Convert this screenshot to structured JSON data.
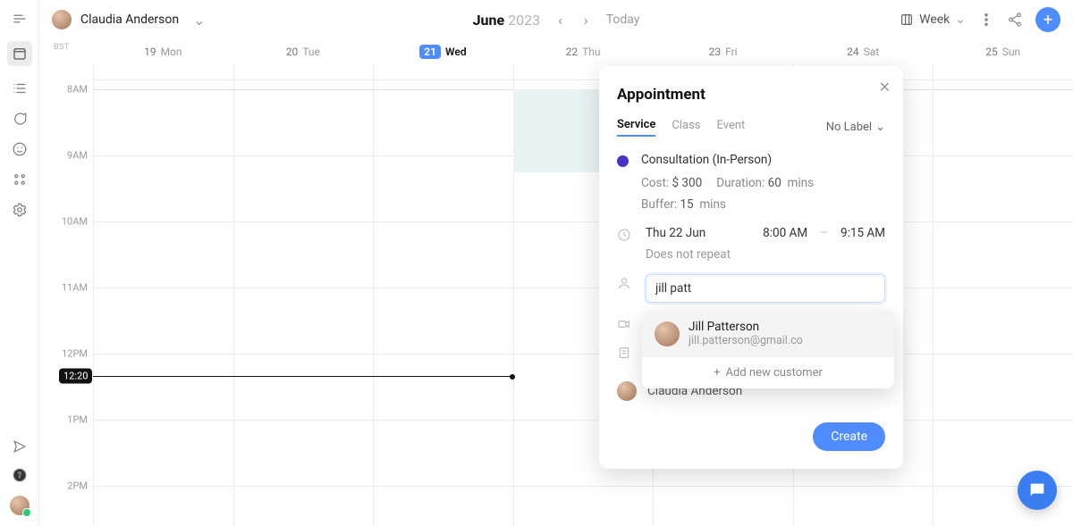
{
  "user": {
    "name": "Claudia Anderson"
  },
  "header": {
    "month": "June",
    "year": "2023",
    "today_label": "Today",
    "view_label": "Week"
  },
  "timezone": "BST",
  "now": "12:20",
  "days": [
    {
      "num": "19",
      "dow": "Mon"
    },
    {
      "num": "20",
      "dow": "Tue"
    },
    {
      "num": "21",
      "dow": "Wed",
      "active": true
    },
    {
      "num": "22",
      "dow": "Thu"
    },
    {
      "num": "23",
      "dow": "Fri"
    },
    {
      "num": "24",
      "dow": "Sat"
    },
    {
      "num": "25",
      "dow": "Sun"
    }
  ],
  "hours": [
    "8AM",
    "9AM",
    "10AM",
    "11AM",
    "12PM",
    "1PM",
    "2PM"
  ],
  "modal": {
    "title": "Appointment",
    "tabs": {
      "service": "Service",
      "class": "Class",
      "event": "Event"
    },
    "label_dropdown": "No Label",
    "service_name": "Consultation (In-Person)",
    "cost_label": "Cost:",
    "cost_value": "$ 300",
    "duration_label": "Duration:",
    "duration_value": "60",
    "duration_unit": "mins",
    "buffer_label": "Buffer:",
    "buffer_value": "15",
    "buffer_unit": "mins",
    "date": "Thu 22 Jun",
    "start": "8:00 AM",
    "sep": "–",
    "end": "9:15 AM",
    "repeat": "Does not repeat",
    "customer_input": "jill patt",
    "suggestion": {
      "name": "Jill Patterson",
      "email": "jill.patterson@gmail.co"
    },
    "add_new": "Add new customer",
    "staff": "Claudia Anderson",
    "create": "Create"
  }
}
